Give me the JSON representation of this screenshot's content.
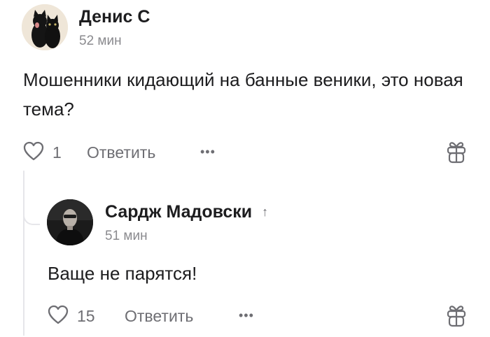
{
  "comment": {
    "author": "Денис С",
    "time": "52 мин",
    "text": "Мошенники кидающий на банные веники, это новая тема?",
    "likes": "1",
    "reply_label": "Ответить",
    "more_label": "•••"
  },
  "reply": {
    "author": "Сардж Мадовски",
    "reply_to_icon": "↑",
    "time": "51 мин",
    "text": "Ваще не парятся!",
    "likes": "15",
    "reply_label": "Ответить",
    "more_label": "•••"
  },
  "icons": {
    "like": "heart-outline-icon",
    "gift": "gift-icon",
    "more": "more-dots-icon",
    "reply_to": "arrow-up-icon"
  },
  "colors": {
    "text": "#1c1c1e",
    "muted": "#6e6e73",
    "thread_line": "#e6e6ea"
  }
}
